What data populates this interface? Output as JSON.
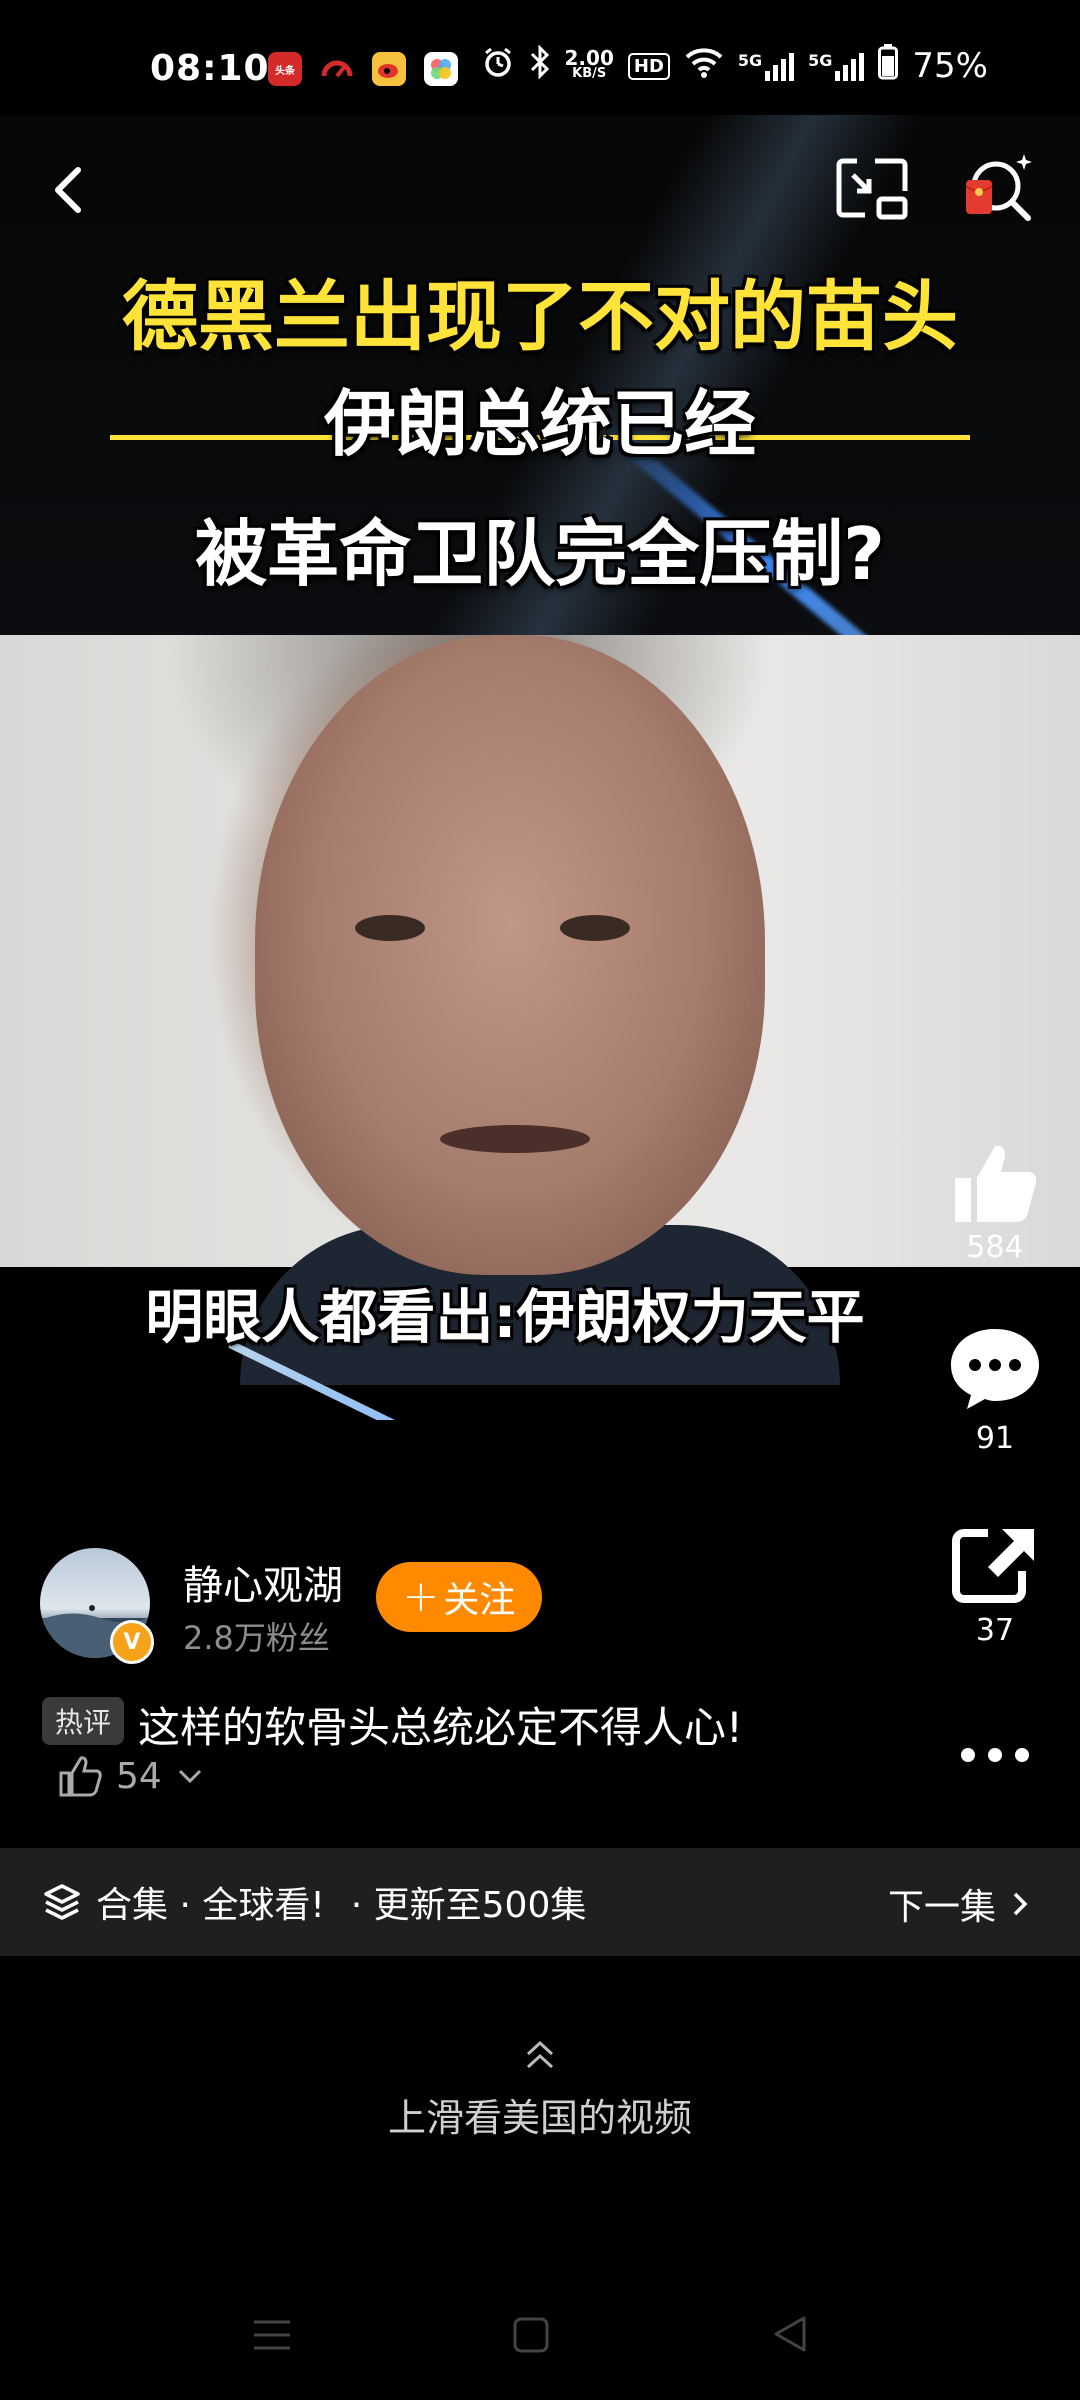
{
  "status_bar": {
    "time": "08:10",
    "app_icons": [
      "toutiao-icon",
      "speed-icon",
      "weibo-icon",
      "photos-icon"
    ],
    "toutiao_label": "头条",
    "net_speed_value": "2.00",
    "net_speed_unit": "KB/S",
    "hd_label": "HD",
    "signal_5g_1": "5G",
    "signal_5g_2": "5G",
    "battery": "75%"
  },
  "video": {
    "title_line_1": "德黑兰出现了不对的苗头",
    "title_line_2": "伊朗总统已经",
    "title_line_3": "被革命卫队完全压制?",
    "subtitle": "明眼人都看出:伊朗权力天平",
    "title_color": "#ffe338"
  },
  "actions": {
    "like_count": "584",
    "comment_count": "91",
    "share_count": "37"
  },
  "author": {
    "name": "静心观湖",
    "fans": "2.8万粉丝",
    "follow_label": "关注",
    "verified_mark": "V"
  },
  "hot_comment": {
    "tag": "热评",
    "text": "这样的软骨头总统必定不得人心!",
    "likes": "54"
  },
  "collection": {
    "title": "合集 · 全球看!",
    "update": "· 更新至500集",
    "next_label": "下一集"
  },
  "swipe_hint": "上滑看美国的视频",
  "colors": {
    "accent": "#ff8a00",
    "verified": "#f7a21b",
    "background": "#000000",
    "collection_bg": "#1f1f1f"
  }
}
